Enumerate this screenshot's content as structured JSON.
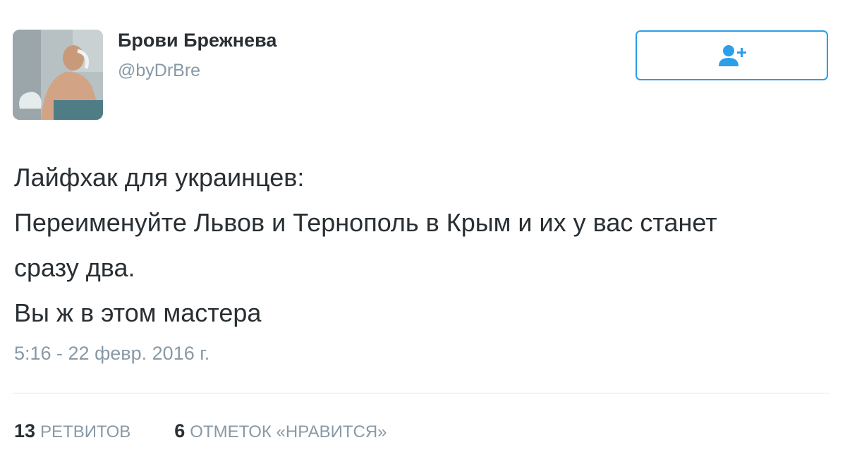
{
  "tweet": {
    "author": {
      "name": "Брови Брежнева",
      "handle": "@byDrBre"
    },
    "follow_icon": "add-user-icon",
    "accent_color": "#2b9fe8",
    "text_lines": [
      "Лайфхак для украинцев:",
      "Переименуйте Львов и Тернополь в Крым и их у вас станет",
      "сразу два.",
      "Вы ж в этом мастера"
    ],
    "timestamp": "5:16 - 22 февр. 2016 г.",
    "stats": {
      "retweets_count": "13",
      "retweets_label": "РЕТВИТОВ",
      "likes_count": "6",
      "likes_label": "ОТМЕТОК «НРАВИТСЯ»"
    }
  }
}
